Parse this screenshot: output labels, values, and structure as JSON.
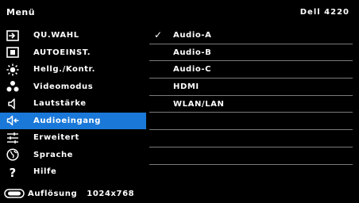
{
  "header": {
    "title": "Menü",
    "model": "Dell 4220"
  },
  "menu": [
    {
      "label": "QU.WAHL",
      "icon": "input-source-icon"
    },
    {
      "label": "AUTOEINST.",
      "icon": "auto-adjust-icon"
    },
    {
      "label": "Hellg./Kontr.",
      "icon": "brightness-icon"
    },
    {
      "label": "Videomodus",
      "icon": "video-mode-icon"
    },
    {
      "label": "Lautstärke",
      "icon": "speaker-icon"
    },
    {
      "label": "Audioeingang",
      "icon": "audio-input-icon",
      "selected": true
    },
    {
      "label": "Erweitert",
      "icon": "advanced-settings-icon"
    },
    {
      "label": "Sprache",
      "icon": "language-icon"
    },
    {
      "label": "Hilfe",
      "icon": "help-icon"
    }
  ],
  "options": [
    {
      "label": "Audio-A",
      "checked": true,
      "check": "✓"
    },
    {
      "label": "Audio-B"
    },
    {
      "label": "Audio-C"
    },
    {
      "label": "HDMI"
    },
    {
      "label": "WLAN/LAN"
    },
    {
      "label": ""
    },
    {
      "label": ""
    },
    {
      "label": ""
    },
    {
      "label": ""
    }
  ],
  "status": {
    "label": "Auflösung",
    "value": "1024x768",
    "icon": "resolution-icon"
  },
  "colors": {
    "selected_bg": "#1a78d8",
    "background": "#000000",
    "text": "#ffffff"
  }
}
